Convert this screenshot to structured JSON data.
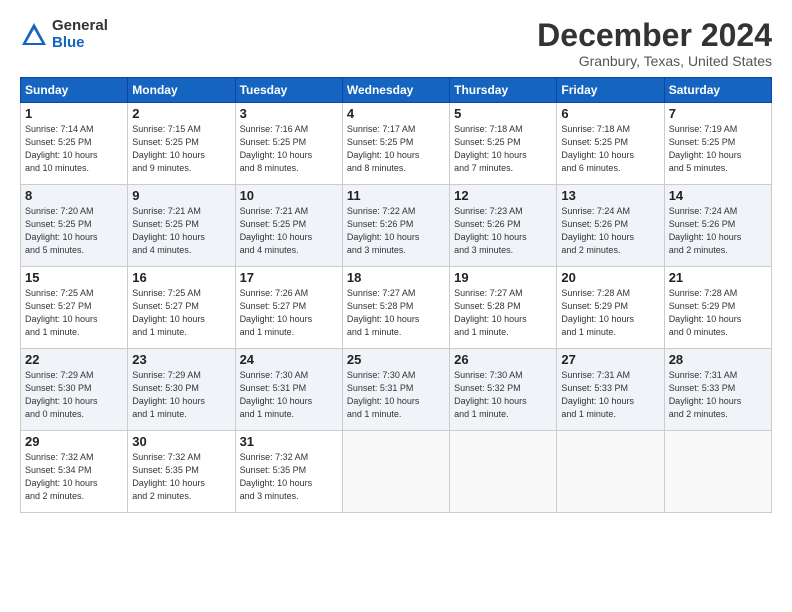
{
  "logo": {
    "general": "General",
    "blue": "Blue"
  },
  "header": {
    "month": "December 2024",
    "location": "Granbury, Texas, United States"
  },
  "weekdays": [
    "Sunday",
    "Monday",
    "Tuesday",
    "Wednesday",
    "Thursday",
    "Friday",
    "Saturday"
  ],
  "weeks": [
    [
      {
        "day": "1",
        "info": "Sunrise: 7:14 AM\nSunset: 5:25 PM\nDaylight: 10 hours\nand 10 minutes."
      },
      {
        "day": "2",
        "info": "Sunrise: 7:15 AM\nSunset: 5:25 PM\nDaylight: 10 hours\nand 9 minutes."
      },
      {
        "day": "3",
        "info": "Sunrise: 7:16 AM\nSunset: 5:25 PM\nDaylight: 10 hours\nand 8 minutes."
      },
      {
        "day": "4",
        "info": "Sunrise: 7:17 AM\nSunset: 5:25 PM\nDaylight: 10 hours\nand 8 minutes."
      },
      {
        "day": "5",
        "info": "Sunrise: 7:18 AM\nSunset: 5:25 PM\nDaylight: 10 hours\nand 7 minutes."
      },
      {
        "day": "6",
        "info": "Sunrise: 7:18 AM\nSunset: 5:25 PM\nDaylight: 10 hours\nand 6 minutes."
      },
      {
        "day": "7",
        "info": "Sunrise: 7:19 AM\nSunset: 5:25 PM\nDaylight: 10 hours\nand 5 minutes."
      }
    ],
    [
      {
        "day": "8",
        "info": "Sunrise: 7:20 AM\nSunset: 5:25 PM\nDaylight: 10 hours\nand 5 minutes."
      },
      {
        "day": "9",
        "info": "Sunrise: 7:21 AM\nSunset: 5:25 PM\nDaylight: 10 hours\nand 4 minutes."
      },
      {
        "day": "10",
        "info": "Sunrise: 7:21 AM\nSunset: 5:25 PM\nDaylight: 10 hours\nand 4 minutes."
      },
      {
        "day": "11",
        "info": "Sunrise: 7:22 AM\nSunset: 5:26 PM\nDaylight: 10 hours\nand 3 minutes."
      },
      {
        "day": "12",
        "info": "Sunrise: 7:23 AM\nSunset: 5:26 PM\nDaylight: 10 hours\nand 3 minutes."
      },
      {
        "day": "13",
        "info": "Sunrise: 7:24 AM\nSunset: 5:26 PM\nDaylight: 10 hours\nand 2 minutes."
      },
      {
        "day": "14",
        "info": "Sunrise: 7:24 AM\nSunset: 5:26 PM\nDaylight: 10 hours\nand 2 minutes."
      }
    ],
    [
      {
        "day": "15",
        "info": "Sunrise: 7:25 AM\nSunset: 5:27 PM\nDaylight: 10 hours\nand 1 minute."
      },
      {
        "day": "16",
        "info": "Sunrise: 7:25 AM\nSunset: 5:27 PM\nDaylight: 10 hours\nand 1 minute."
      },
      {
        "day": "17",
        "info": "Sunrise: 7:26 AM\nSunset: 5:27 PM\nDaylight: 10 hours\nand 1 minute."
      },
      {
        "day": "18",
        "info": "Sunrise: 7:27 AM\nSunset: 5:28 PM\nDaylight: 10 hours\nand 1 minute."
      },
      {
        "day": "19",
        "info": "Sunrise: 7:27 AM\nSunset: 5:28 PM\nDaylight: 10 hours\nand 1 minute."
      },
      {
        "day": "20",
        "info": "Sunrise: 7:28 AM\nSunset: 5:29 PM\nDaylight: 10 hours\nand 1 minute."
      },
      {
        "day": "21",
        "info": "Sunrise: 7:28 AM\nSunset: 5:29 PM\nDaylight: 10 hours\nand 0 minutes."
      }
    ],
    [
      {
        "day": "22",
        "info": "Sunrise: 7:29 AM\nSunset: 5:30 PM\nDaylight: 10 hours\nand 0 minutes."
      },
      {
        "day": "23",
        "info": "Sunrise: 7:29 AM\nSunset: 5:30 PM\nDaylight: 10 hours\nand 1 minute."
      },
      {
        "day": "24",
        "info": "Sunrise: 7:30 AM\nSunset: 5:31 PM\nDaylight: 10 hours\nand 1 minute."
      },
      {
        "day": "25",
        "info": "Sunrise: 7:30 AM\nSunset: 5:31 PM\nDaylight: 10 hours\nand 1 minute."
      },
      {
        "day": "26",
        "info": "Sunrise: 7:30 AM\nSunset: 5:32 PM\nDaylight: 10 hours\nand 1 minute."
      },
      {
        "day": "27",
        "info": "Sunrise: 7:31 AM\nSunset: 5:33 PM\nDaylight: 10 hours\nand 1 minute."
      },
      {
        "day": "28",
        "info": "Sunrise: 7:31 AM\nSunset: 5:33 PM\nDaylight: 10 hours\nand 2 minutes."
      }
    ],
    [
      {
        "day": "29",
        "info": "Sunrise: 7:32 AM\nSunset: 5:34 PM\nDaylight: 10 hours\nand 2 minutes."
      },
      {
        "day": "30",
        "info": "Sunrise: 7:32 AM\nSunset: 5:35 PM\nDaylight: 10 hours\nand 2 minutes."
      },
      {
        "day": "31",
        "info": "Sunrise: 7:32 AM\nSunset: 5:35 PM\nDaylight: 10 hours\nand 3 minutes."
      },
      {
        "day": "",
        "info": ""
      },
      {
        "day": "",
        "info": ""
      },
      {
        "day": "",
        "info": ""
      },
      {
        "day": "",
        "info": ""
      }
    ]
  ]
}
